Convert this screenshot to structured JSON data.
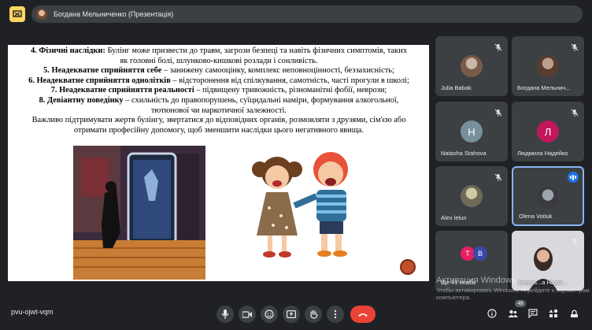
{
  "presenter_bar": {
    "text": "Богдана Мельниченко (Презентація)"
  },
  "slide": {
    "lines": [
      {
        "bold": "4. Фізичні наслідки:",
        "rest": " Булінг може призвести до травм, загрози безпеці та навіть фізичних симптомів, таких"
      },
      {
        "bold": "",
        "rest": "як головні болі, шлунково-кишкові розлади і сонливість."
      },
      {
        "bold": "5. Неадекватне сприйняття себе",
        "rest": " – занижену самооцінку, комплекс неповноцінності, беззахисність;"
      },
      {
        "bold": "6. Неадекватне сприйняття однолітків",
        "rest": " – відсторонення від спілкування, самотність, частi прогули в школі;"
      },
      {
        "bold": "7. Неадекватне сприйняття реальності",
        "rest": " – підвищену тривожність, різноманітні фобії, неврози;"
      },
      {
        "bold": "8. Девіантну поведінку",
        "rest": " – схильність до правопорушень, суїцидальні наміри, формування алкогольної,"
      },
      {
        "bold": "",
        "rest": "тютюнової чи наркотичної залежності."
      },
      {
        "bold": "",
        "rest": "Важливо підтримувати жертв булінгу, звертатися до відповідних органів, розмовляти з друзями, сім'єю або"
      },
      {
        "bold": "",
        "rest": "отримати професійну допомогу, щоб зменшити наслідки цього негативного явища."
      }
    ]
  },
  "participants": [
    {
      "name": "Julia Babak",
      "type": "photo",
      "muted": true
    },
    {
      "name": "Богдана Мельнич...",
      "type": "photo",
      "muted": true
    },
    {
      "name": "Natasha Stahova",
      "type": "initial",
      "initial": "Н",
      "color": "#78909c",
      "muted": true
    },
    {
      "name": "Людмила Надейко",
      "type": "initial",
      "initial": "Л",
      "color": "#c2185b",
      "muted": true
    },
    {
      "name": "Alex lelun",
      "type": "photo",
      "muted": true
    },
    {
      "name": "Olena Voituk",
      "type": "photo",
      "muted": false,
      "speaking": true
    },
    {
      "name": "Ще 41 особа",
      "type": "others",
      "initials": [
        "Т",
        "В"
      ],
      "colors": [
        "#e91e63",
        "#3949ab"
      ]
    },
    {
      "name": "Фекуль...а Надія...",
      "type": "video",
      "muted": true
    }
  ],
  "watermark": {
    "title": "Активация Windows",
    "subtitle": "Чтобы активировать Windows, перейдите к параметрам компьютера."
  },
  "bottom": {
    "meeting_code": "pvu-ojwt-vqm",
    "participant_count": "49"
  },
  "colors": {
    "background": "#202124",
    "tile": "#3c4043",
    "end_call": "#ea4335",
    "accent": "#8ab4f8"
  }
}
